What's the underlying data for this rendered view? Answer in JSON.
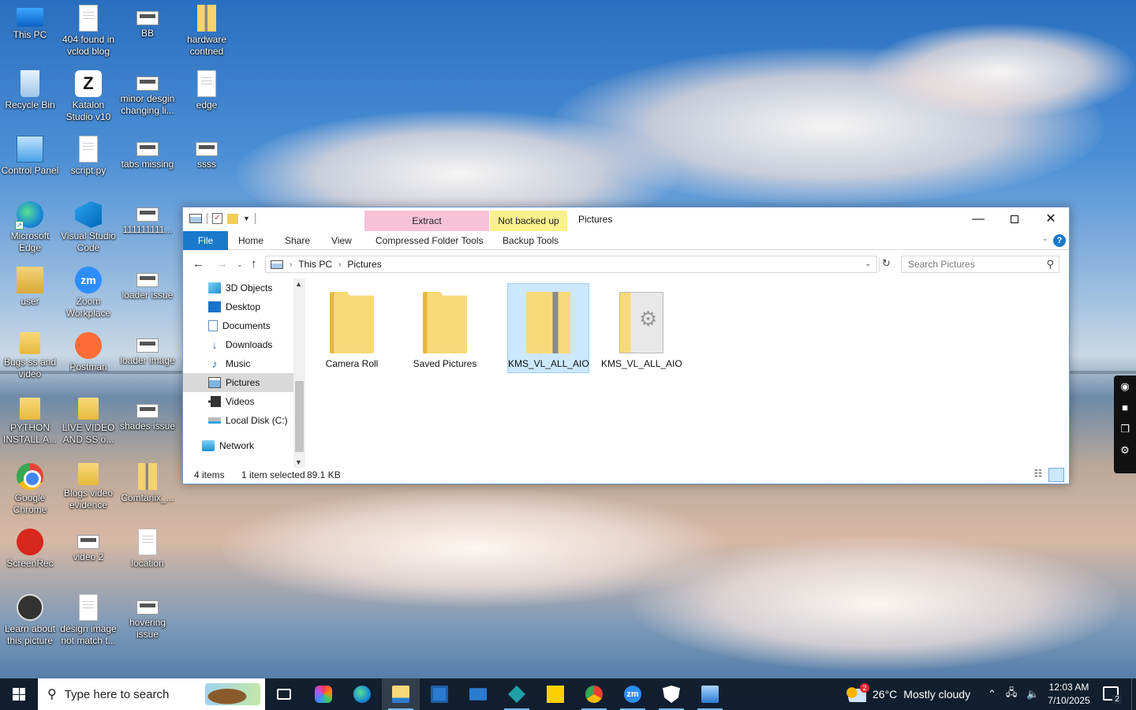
{
  "desktop": {
    "icons": [
      {
        "label": "This PC",
        "icon": "this-pc-icon"
      },
      {
        "label": "404 found in vclod blog",
        "icon": "document-icon"
      },
      {
        "label": "BB",
        "icon": "image-icon"
      },
      {
        "label": "hardware contned",
        "icon": "zip-folder-icon"
      },
      {
        "label": "Recycle Bin",
        "icon": "recycle-bin-icon"
      },
      {
        "label": "Katalon Studio v10",
        "icon": "katalon-icon"
      },
      {
        "label": "minor desgin changing li...",
        "icon": "image-icon"
      },
      {
        "label": "edge",
        "icon": "document-icon"
      },
      {
        "label": "Control Panel",
        "icon": "control-panel-icon"
      },
      {
        "label": "script.py",
        "icon": "document-icon"
      },
      {
        "label": "tabs missing",
        "icon": "image-icon"
      },
      {
        "label": "ssss",
        "icon": "image-icon"
      },
      {
        "label": "Microsoft Edge",
        "icon": "edge-icon"
      },
      {
        "label": "Visual Studio Code",
        "icon": "vscode-icon"
      },
      {
        "label": "111111111...",
        "icon": "image-icon"
      },
      {
        "label": "user",
        "icon": "user-folder-icon"
      },
      {
        "label": "Zoom Workplace",
        "icon": "zoom-icon"
      },
      {
        "label": "loader issue",
        "icon": "image-icon"
      },
      {
        "label": "Bugs ss and video",
        "icon": "folder-icon"
      },
      {
        "label": "Postman",
        "icon": "postman-icon"
      },
      {
        "label": "loader image",
        "icon": "image-icon"
      },
      {
        "label": "PYTHON INSTALL A...",
        "icon": "folder-icon"
      },
      {
        "label": "LIVE VIDEO AND SS o...",
        "icon": "folder-icon"
      },
      {
        "label": "shades issue",
        "icon": "image-icon"
      },
      {
        "label": "Google Chrome",
        "icon": "chrome-icon"
      },
      {
        "label": "Blogs video evidence",
        "icon": "folder-icon"
      },
      {
        "label": "Comtanix_...",
        "icon": "zip-folder-icon"
      },
      {
        "label": "ScreenRec",
        "icon": "screenrec-icon"
      },
      {
        "label": "video 2",
        "icon": "image-icon"
      },
      {
        "label": "location",
        "icon": "document-icon"
      },
      {
        "label": "Learn about this picture",
        "icon": "learn-icon"
      },
      {
        "label": "design image not match t...",
        "icon": "document-icon"
      },
      {
        "label": "hovering issue",
        "icon": "image-icon"
      }
    ]
  },
  "explorer": {
    "title": "Pictures",
    "context_tabs": {
      "extract": "Extract",
      "backup": "Not backed up"
    },
    "ribbon_tabs": {
      "file": "File",
      "home": "Home",
      "share": "Share",
      "view": "View",
      "compressed": "Compressed Folder Tools",
      "backup_tools": "Backup Tools"
    },
    "help": "?",
    "breadcrumb": [
      "This PC",
      "Pictures"
    ],
    "search_placeholder": "Search Pictures",
    "nav_items": [
      {
        "label": "3D Objects",
        "icon": "3d-objects-icon"
      },
      {
        "label": "Desktop",
        "icon": "desktop-icon"
      },
      {
        "label": "Documents",
        "icon": "documents-icon"
      },
      {
        "label": "Downloads",
        "icon": "downloads-icon"
      },
      {
        "label": "Music",
        "icon": "music-icon"
      },
      {
        "label": "Pictures",
        "icon": "pictures-icon",
        "selected": true
      },
      {
        "label": "Videos",
        "icon": "videos-icon"
      },
      {
        "label": "Local Disk (C:)",
        "icon": "local-disk-icon"
      }
    ],
    "network": "Network",
    "files": [
      {
        "name": "Camera Roll",
        "type": "folder"
      },
      {
        "name": "Saved Pictures",
        "type": "folder"
      },
      {
        "name": "KMS_VL_ALL_AIO",
        "type": "zip",
        "selected": true
      },
      {
        "name": "KMS_VL_ALL_AIO",
        "type": "exe"
      }
    ],
    "status": {
      "items": "4 items",
      "selected": "1 item selected",
      "size": "89.1 KB"
    }
  },
  "taskbar": {
    "search_placeholder": "Type here to search",
    "weather": {
      "temp": "26°C",
      "condition": "Mostly cloudy",
      "badge": "2"
    },
    "clock": {
      "time": "12:03 AM",
      "date": "7/10/2025"
    },
    "notifications": "2"
  }
}
